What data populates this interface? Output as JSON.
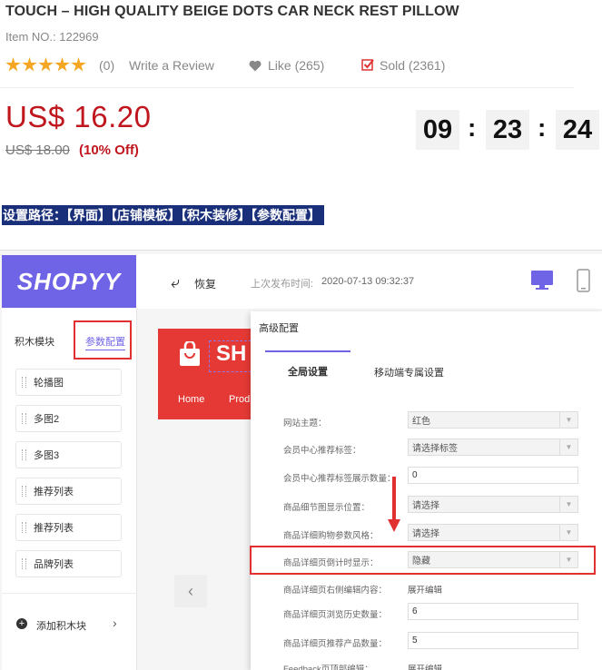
{
  "product": {
    "title": "TOUCH – HIGH QUALITY BEIGE DOTS CAR NECK REST PILLOW",
    "item_no": "Item NO.: 122969",
    "rating_count": "(0)",
    "write_review": "Write a Review",
    "like": "Like (265)",
    "sold": "Sold (2361)",
    "price": "US$ 16.20",
    "old_price": "US$ 18.00",
    "discount": "(10% Off)",
    "rating_stars": 5
  },
  "countdown": {
    "hours": "09",
    "minutes": "23",
    "seconds": "24",
    "separator": ":"
  },
  "path_label": "设置路径：【界面】【店铺模板】【积木装修】【参数配置】",
  "admin": {
    "logo": "SHOPYY",
    "undo": "恢复",
    "last_publish_label": "上次发布时间:",
    "last_publish_date": "2020-07-13 09:32:37",
    "sidebar": {
      "tab_blocks": "积木模块",
      "tab_params": "参数配置",
      "blocks": [
        "轮播图",
        "多图2",
        "多图3",
        "推荐列表",
        "推荐列表",
        "品牌列表"
      ],
      "add_block": "添加积木块"
    },
    "preview": {
      "brand": "SH",
      "nav_home": "Home",
      "nav_products": "Prod"
    },
    "modal": {
      "title": "高级配置",
      "tab_global": "全局设置",
      "tab_mobile": "移动端专属设置",
      "fields": [
        {
          "label": "网站主题：",
          "value": "红色",
          "kind": "select"
        },
        {
          "label": "会员中心推荐标签：",
          "value": "请选择标签",
          "kind": "select"
        },
        {
          "label": "会员中心推荐标签展示数量：",
          "value": "0",
          "kind": "input"
        },
        {
          "label": "商品细节图显示位置：",
          "value": "请选择",
          "kind": "select"
        },
        {
          "label": "商品详细购物参数风格：",
          "value": "请选择",
          "kind": "select"
        },
        {
          "label": "商品详细页倒计时显示：",
          "value": "隐藏",
          "kind": "select"
        },
        {
          "label": "商品详细页右侧编辑内容：",
          "value": "展开编辑",
          "kind": "text"
        },
        {
          "label": "商品详细页浏览历史数量：",
          "value": "6",
          "kind": "input"
        },
        {
          "label": "商品详细页推荐产品数量：",
          "value": "5",
          "kind": "input"
        },
        {
          "label": "Feedback页顶部编辑：",
          "value": "展开编辑",
          "kind": "text"
        }
      ]
    }
  },
  "colors": {
    "price_red": "#c0161e",
    "star": "#f5a623",
    "brand_purple": "#7064e6",
    "highlight_red": "#e03030",
    "path_bg": "#1a2f7a"
  }
}
